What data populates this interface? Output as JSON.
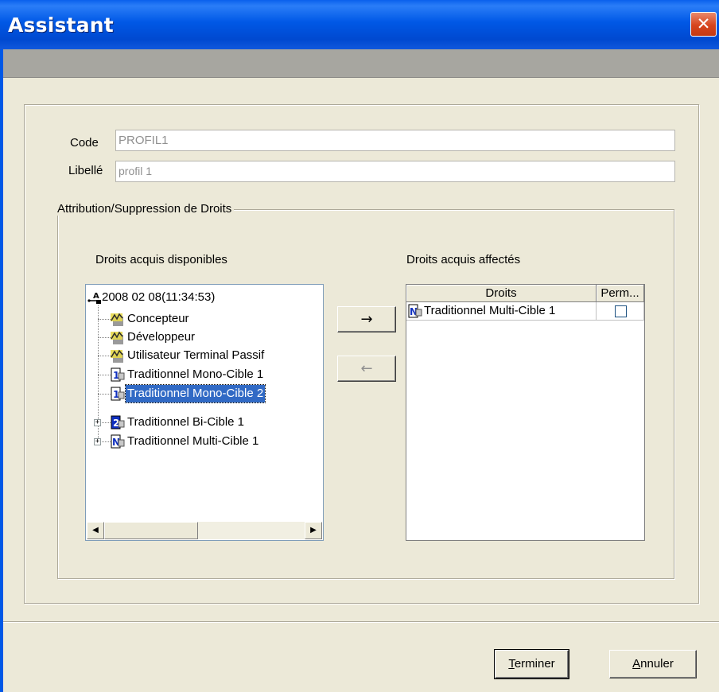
{
  "window": {
    "title": "Assistant",
    "close_glyph": "✕"
  },
  "form": {
    "code_label": "Code",
    "code_value": "PROFIL1",
    "libelle_label": "Libellé",
    "libelle_value": "profil 1"
  },
  "group": {
    "legend": "Attribution/Suppression de Droits",
    "available_title": "Droits acquis disponibles",
    "assigned_title": "Droits acquis affectés"
  },
  "tree": {
    "root": {
      "label": "2008 02 08(11:34:53)",
      "icon": "tree-root-icon"
    },
    "items": [
      {
        "label": "Concepteur",
        "icon": "role-icon"
      },
      {
        "label": "Développeur",
        "icon": "role-icon"
      },
      {
        "label": "Utilisateur Terminal Passif",
        "icon": "role-icon"
      },
      {
        "label": "Traditionnel Mono-Cible 1",
        "icon": "mono-target-icon"
      },
      {
        "label": "Traditionnel Mono-Cible 2",
        "icon": "mono-target-icon",
        "selected": true
      },
      {
        "label": "Traditionnel Bi-Cible 1",
        "icon": "bi-target-icon",
        "expandable": true
      },
      {
        "label": "Traditionnel Multi-Cible 1",
        "icon": "multi-target-icon",
        "expandable": true
      }
    ]
  },
  "transfer": {
    "add_glyph": "→",
    "remove_glyph": "←"
  },
  "assigned_table": {
    "columns": [
      "Droits",
      "Perm..."
    ],
    "rows": [
      {
        "droit": "Traditionnel Multi-Cible 1",
        "icon": "multi-target-icon",
        "perm": false
      }
    ]
  },
  "buttons": {
    "finish_mnemonic": "T",
    "finish_rest": "erminer",
    "cancel_mnemonic": "A",
    "cancel_rest": "nnuler"
  },
  "colors": {
    "titlebar": "#0058e6",
    "selection": "#316ac5",
    "dialog_bg": "#ece9d8",
    "header_band": "#a7a6a0"
  }
}
